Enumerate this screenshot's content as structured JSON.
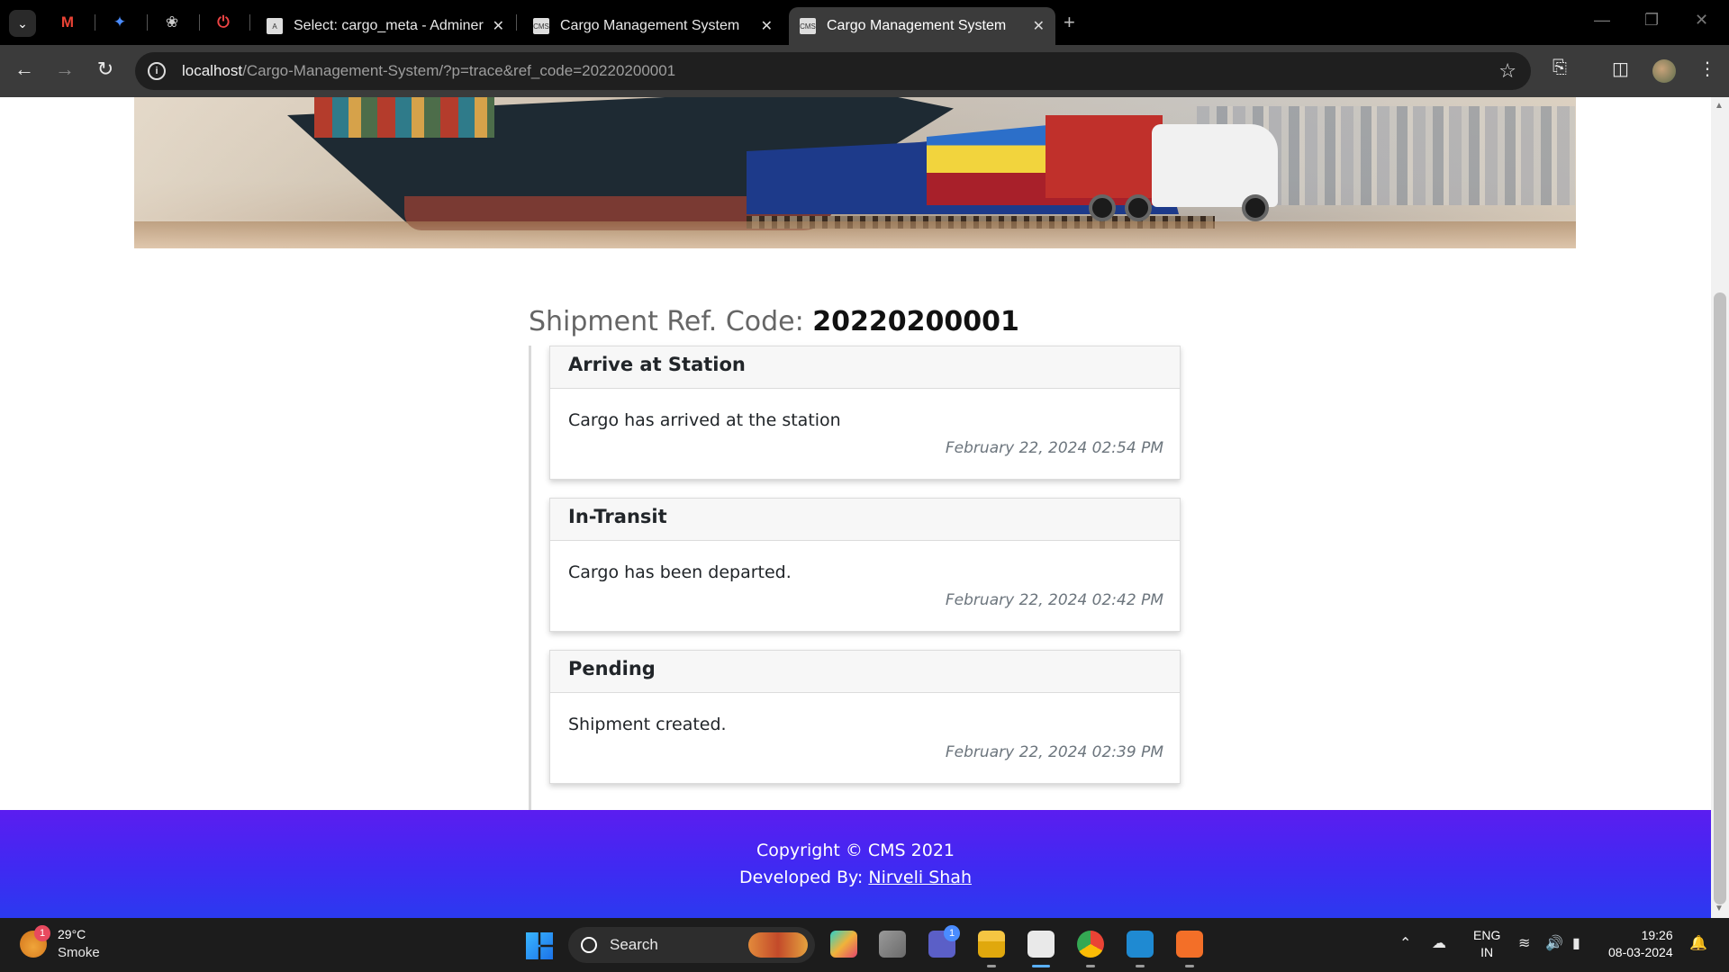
{
  "browser": {
    "tabs": [
      {
        "label": "Select: cargo_meta - Adminer",
        "active": false
      },
      {
        "label": "Cargo Management System",
        "active": false
      },
      {
        "label": "Cargo Management System",
        "active": true
      }
    ],
    "url_host": "localhost",
    "url_path": "/Cargo-Management-System/?p=trace&ref_code=20220200001"
  },
  "trace": {
    "title_label": "Shipment Ref. Code: ",
    "ref_code": "20220200001",
    "entries": [
      {
        "status": "Arrive at Station",
        "message": "Cargo has arrived at the station",
        "date": "February 22, 2024 02:54 PM"
      },
      {
        "status": "In-Transit",
        "message": "Cargo has been departed.",
        "date": "February 22, 2024 02:42 PM"
      },
      {
        "status": "Pending",
        "message": "Shipment created.",
        "date": "February 22, 2024 02:39 PM"
      }
    ]
  },
  "footer": {
    "copyright": "Copyright © CMS 2021",
    "developed_by_label": "Developed By: ",
    "developer": "Nirveli Shah"
  },
  "taskbar": {
    "weather_badge": "1",
    "temperature": "29°C",
    "weather": "Smoke",
    "search_label": "Search",
    "lang_top": "ENG",
    "lang_bottom": "IN",
    "time": "19:26",
    "date": "08-03-2024",
    "teams_badge": "1"
  },
  "colors": {
    "footer_gradient_start": "#5b1df0",
    "footer_gradient_end": "#2b3af0",
    "tab_active": "#3b3b3b",
    "omnibox": "#1f1f1f"
  },
  "icons": [
    "tab-search-icon",
    "gmail-icon",
    "gemini-icon",
    "chatgpt-icon",
    "toggl-icon",
    "adminer-icon",
    "back-icon",
    "forward-icon",
    "reload-icon",
    "site-info-icon",
    "bookmark-star-icon",
    "extensions-icon",
    "sidepanel-icon",
    "profile-avatar",
    "menu-kebab-icon"
  ]
}
